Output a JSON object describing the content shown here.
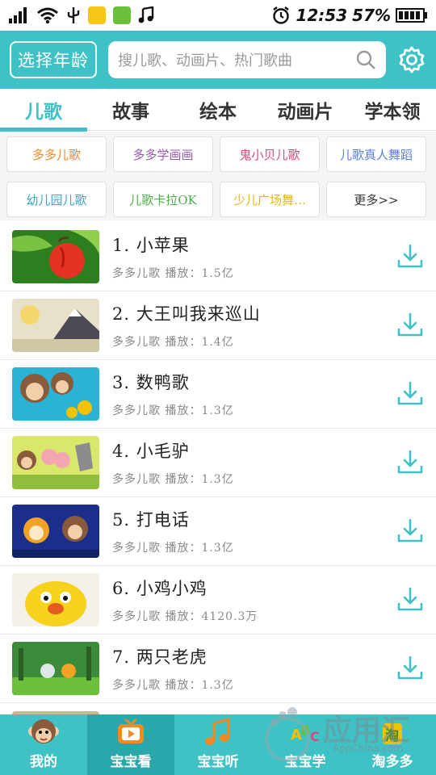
{
  "status_bar": {
    "time": "12:53",
    "battery": "57%"
  },
  "header": {
    "age_button": "选择年龄",
    "search_placeholder": "搜儿歌、动画片、热门歌曲"
  },
  "tabs": [
    {
      "label": "儿歌",
      "active": true
    },
    {
      "label": "故事",
      "active": false
    },
    {
      "label": "绘本",
      "active": false
    },
    {
      "label": "动画片",
      "active": false
    },
    {
      "label": "学本领",
      "active": false
    }
  ],
  "chips": [
    {
      "label": "多多儿歌",
      "color": "#f08a24"
    },
    {
      "label": "多多学画画",
      "color": "#9b59b6"
    },
    {
      "label": "鬼小贝儿歌",
      "color": "#e0457b"
    },
    {
      "label": "儿歌真人舞蹈",
      "color": "#5b7fd6"
    },
    {
      "label": "幼儿园儿歌",
      "color": "#3aa6c8"
    },
    {
      "label": "儿歌卡拉OK",
      "color": "#4cae4c"
    },
    {
      "label": "少儿广场舞…",
      "color": "#e6b422"
    },
    {
      "label": "更多>>",
      "color": "#333333"
    }
  ],
  "songs": [
    {
      "title": "1. 小苹果",
      "meta": "多多儿歌  播放：1.5亿"
    },
    {
      "title": "2. 大王叫我来巡山",
      "meta": "多多儿歌  播放：1.4亿"
    },
    {
      "title": "3. 数鸭歌",
      "meta": "多多儿歌  播放：1.3亿"
    },
    {
      "title": "4. 小毛驴",
      "meta": "多多儿歌  播放：1.3亿"
    },
    {
      "title": "5. 打电话",
      "meta": "多多儿歌  播放：1.3亿"
    },
    {
      "title": "6. 小鸡小鸡",
      "meta": "多多儿歌  播放：4120.3万"
    },
    {
      "title": "7. 两只老虎",
      "meta": "多多儿歌  播放：1.3亿"
    }
  ],
  "bottom_nav": [
    {
      "label": "我的",
      "icon": "monkey-icon",
      "active": false
    },
    {
      "label": "宝宝看",
      "icon": "tv-icon",
      "active": true
    },
    {
      "label": "宝宝听",
      "icon": "music-note-icon",
      "active": false
    },
    {
      "label": "宝宝学",
      "icon": "abc-icon",
      "active": false
    },
    {
      "label": "淘多多",
      "icon": "shop-bag-icon",
      "active": false
    }
  ],
  "watermark": {
    "text": "应用汇",
    "sub": "AppChina.com"
  },
  "colors": {
    "accent": "#3fc2c5",
    "accent_dark": "#2aa7aa",
    "download": "#3fc2c5"
  }
}
